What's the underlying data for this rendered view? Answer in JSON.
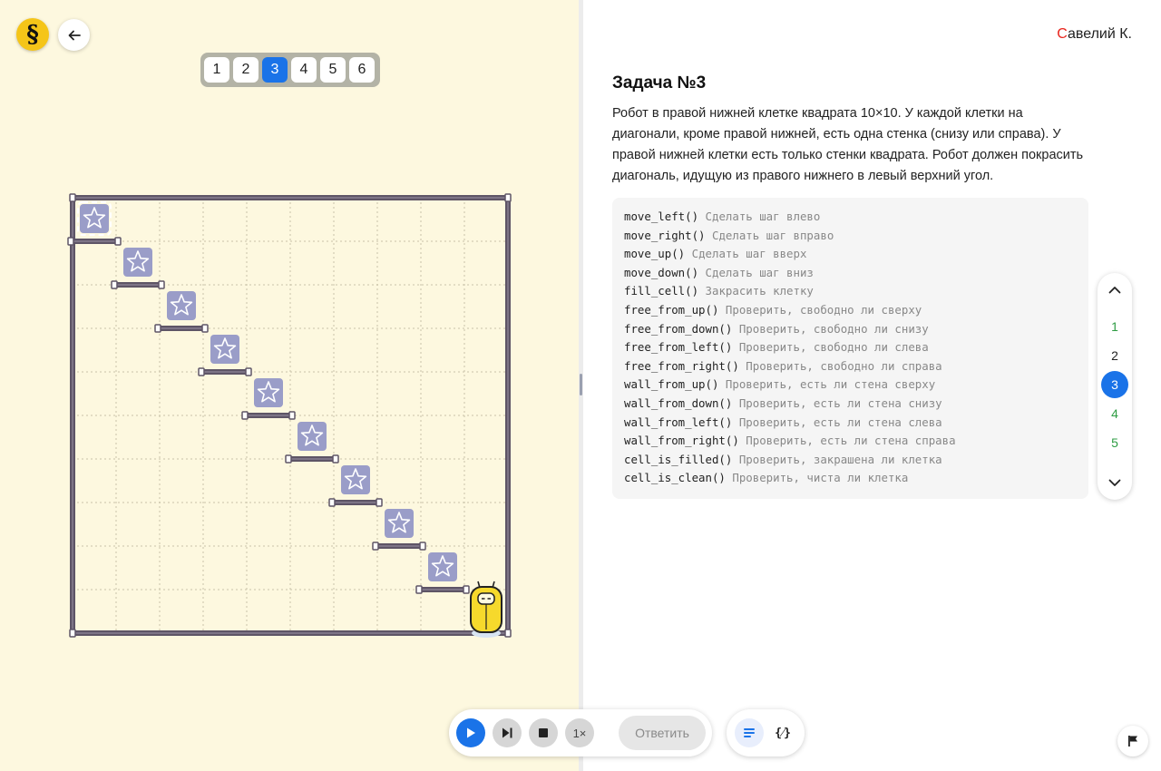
{
  "app": {
    "logo_glyph": "§"
  },
  "levels": {
    "items": [
      "1",
      "2",
      "3",
      "4",
      "5",
      "6"
    ],
    "active_index": 2
  },
  "user": {
    "first_letter": "С",
    "rest_name": "авелий К."
  },
  "task": {
    "title": "Задача №3",
    "description": "Робот в правой нижней клетке квадрата 10×10. У каждой клетки на диагонали, кроме правой нижней, есть одна стенка (снизу или справа). У правой нижней клетки есть только стенки квадрата. Робот должен покрасить диагональ, идущую из правого нижнего в левый верхний угол."
  },
  "api": [
    {
      "fn": "move_left()",
      "desc": "Сделать шаг влево"
    },
    {
      "fn": "move_right()",
      "desc": "Сделать шаг вправо"
    },
    {
      "fn": "move_up()",
      "desc": "Сделать шаг вверх"
    },
    {
      "fn": "move_down()",
      "desc": "Сделать шаг вниз"
    },
    {
      "fn": "fill_cell()",
      "desc": "Закрасить клетку"
    },
    {
      "fn": "free_from_up()",
      "desc": "Проверить, свободно ли сверху"
    },
    {
      "fn": "free_from_down()",
      "desc": "Проверить, свободно ли снизу"
    },
    {
      "fn": "free_from_left()",
      "desc": "Проверить, свободно ли слева"
    },
    {
      "fn": "free_from_right()",
      "desc": "Проверить, свободно ли справа"
    },
    {
      "fn": "wall_from_up()",
      "desc": "Проверить, есть ли стена сверху"
    },
    {
      "fn": "wall_from_down()",
      "desc": "Проверить, есть ли стена снизу"
    },
    {
      "fn": "wall_from_left()",
      "desc": "Проверить, есть ли стена слева"
    },
    {
      "fn": "wall_from_right()",
      "desc": "Проверить, есть ли стена справа"
    },
    {
      "fn": "cell_is_filled()",
      "desc": "Проверить, закрашена ли клетка"
    },
    {
      "fn": "cell_is_clean()",
      "desc": "Проверить, чиста ли клетка"
    }
  ],
  "task_nav": {
    "items": [
      {
        "label": "1",
        "state": "solved"
      },
      {
        "label": "2",
        "state": "neutral"
      },
      {
        "label": "3",
        "state": "current"
      },
      {
        "label": "4",
        "state": "solved"
      },
      {
        "label": "5",
        "state": "solved"
      }
    ]
  },
  "player": {
    "speed_label": "1×",
    "answer_label": "Ответить"
  },
  "view_toggle": {
    "code_label": "{⁄}"
  },
  "colors": {
    "board_bg": "#fdf8df",
    "wall": "#5e5566",
    "star_tile": "#9a9dc8",
    "accent": "#1a73e8",
    "robot": "#f6d92c",
    "solved": "#2e9c43"
  },
  "board": {
    "size": 10,
    "robot_cell": [
      9,
      9
    ],
    "star_cells": [
      [
        0,
        0
      ],
      [
        1,
        1
      ],
      [
        2,
        2
      ],
      [
        3,
        3
      ],
      [
        4,
        4
      ],
      [
        5,
        5
      ],
      [
        6,
        6
      ],
      [
        7,
        7
      ],
      [
        8,
        8
      ]
    ],
    "first_cell_dashed": true,
    "walls_below": [
      0,
      1,
      2,
      3,
      4,
      5,
      6,
      7,
      8
    ]
  }
}
